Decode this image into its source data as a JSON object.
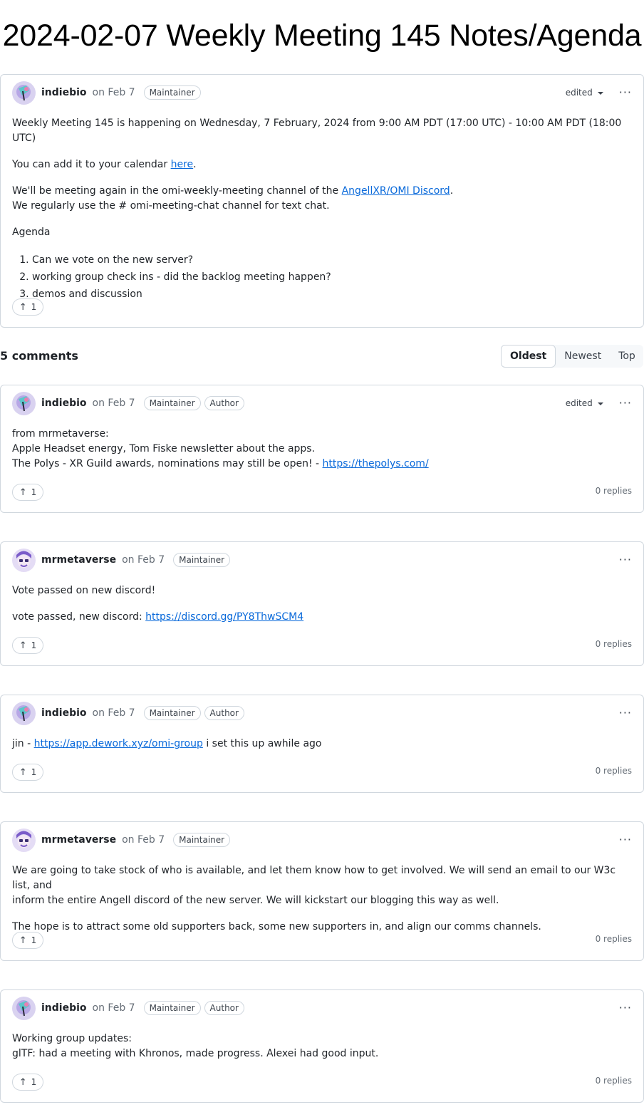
{
  "page": {
    "title": "2024-02-07 Weekly Meeting 145 Notes/Agenda"
  },
  "post": {
    "author": "indiebio",
    "date": "on Feb 7",
    "badges": [
      "Maintainer"
    ],
    "edited_label": "edited",
    "menu_label": "···",
    "line1": "Weekly Meeting 145 is happening on Wednesday, 7 February, 2024 from 9:00 AM PDT (17:00 UTC) - 10:00 AM PDT (18:00 UTC)",
    "calendar_prefix": "You can add it to your calendar ",
    "calendar_link": "here",
    "calendar_suffix": ".",
    "meeting_prefix": "We'll be meeting again in the omi-weekly-meeting channel of the ",
    "meeting_link": "AngellXR/OMI Discord",
    "meeting_suffix": ".",
    "chat_line": "We regularly use the # omi-meeting-chat channel for text chat.",
    "agenda_heading": "Agenda",
    "agenda_items": [
      "Can we vote on the new server?",
      "working group check ins - did the backlog meeting happen?",
      "demos and discussion"
    ],
    "upvotes": "1"
  },
  "comments_header": {
    "count_label": "5 comments",
    "sort_options": [
      "Oldest",
      "Newest",
      "Top"
    ],
    "active_sort": "Oldest"
  },
  "comments": [
    {
      "author": "indiebio",
      "date": "on Feb 7",
      "badges": [
        "Maintainer",
        "Author"
      ],
      "edited_label": "edited",
      "line1": "from mrmetaverse:",
      "line2": "Apple Headset energy, Tom Fiske newsletter about the apps.",
      "line3_prefix": "The Polys - XR Guild awards, nominations may still be open! - ",
      "line3_link": "https://thepolys.com/",
      "upvotes": "1",
      "replies": "0 replies"
    },
    {
      "author": "mrmetaverse",
      "date": "on Feb 7",
      "badges": [
        "Maintainer"
      ],
      "line1": "Vote passed on new discord!",
      "line2_prefix": "vote passed, new discord: ",
      "line2_link": "https://discord.gg/PY8ThwSCM4",
      "upvotes": "1",
      "replies": "0 replies"
    },
    {
      "author": "indiebio",
      "date": "on Feb 7",
      "badges": [
        "Maintainer",
        "Author"
      ],
      "line1_prefix": "jin - ",
      "line1_link": "https://app.dework.xyz/omi-group",
      "line1_suffix": " i set this up awhile ago",
      "upvotes": "1",
      "replies": "0 replies"
    },
    {
      "author": "mrmetaverse",
      "date": "on Feb 7",
      "badges": [
        "Maintainer"
      ],
      "line1": "We are going to take stock of who is available, and let them know how to get involved. We will send an email to our W3c list, and",
      "line2": "inform the entire Angell discord of the new server. We will kickstart our blogging this way as well.",
      "line3": "The hope is to attract some old supporters back, some new supporters in, and align our comms channels.",
      "upvotes": "1",
      "replies": "0 replies"
    },
    {
      "author": "indiebio",
      "date": "on Feb 7",
      "badges": [
        "Maintainer",
        "Author"
      ],
      "line1": "Working group updates:",
      "line2": "glTF: had a meeting with Khronos, made progress. Alexei had good input.",
      "upvotes": "1",
      "replies": "0 replies"
    }
  ],
  "icons": {
    "upvote": "arrow-up-icon",
    "menu": "kebab-horizontal-icon",
    "caret": "triangle-down-icon"
  },
  "colors": {
    "link": "#0969da",
    "border": "#d0d7de",
    "muted": "#656d76"
  }
}
